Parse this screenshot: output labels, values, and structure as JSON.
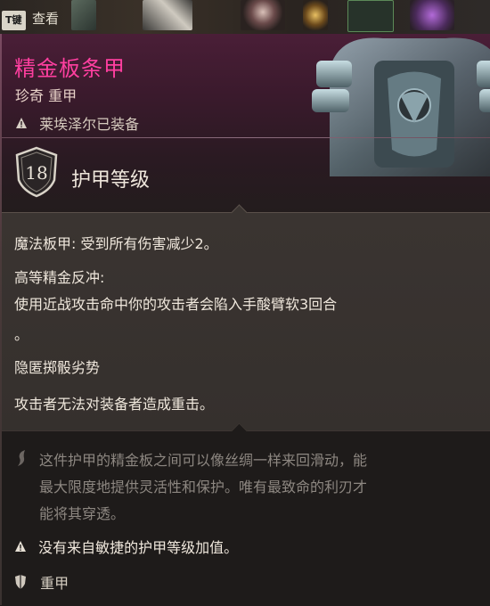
{
  "top_bar": {
    "key_hint": "T键",
    "action_label": "查看"
  },
  "item": {
    "name": "精金板条甲",
    "subtitle": "珍奇 重甲",
    "equipped_notice": "莱埃泽尔已装备",
    "armor_class": "18",
    "armor_class_label": "护甲等级"
  },
  "properties": [
    {
      "text": "魔法板甲: 受到所有伤害减少2。"
    },
    {
      "text": "高等精金反冲:"
    },
    {
      "text": "使用近战攻击命中你的攻击者会陷入手酸臂软3回合"
    },
    {
      "text": "。"
    },
    {
      "text": "隐匿掷骰劣势"
    },
    {
      "text": "攻击者无法对装备者造成重击。"
    }
  ],
  "description": {
    "flavor_lines": [
      "这件护甲的精金板之间可以像丝绸一样来回滑动，能",
      "最大限度地提供灵活性和保护。唯有最致命的利刃才",
      "能将其穿透。"
    ],
    "note": "没有来自敏捷的护甲等级加值。",
    "type": "重甲"
  },
  "colors": {
    "item_name": "#ff3fa0",
    "header_bg": "#4a1e37",
    "body_bg": "#3a3431",
    "desc_bg": "#1e1b1a"
  }
}
